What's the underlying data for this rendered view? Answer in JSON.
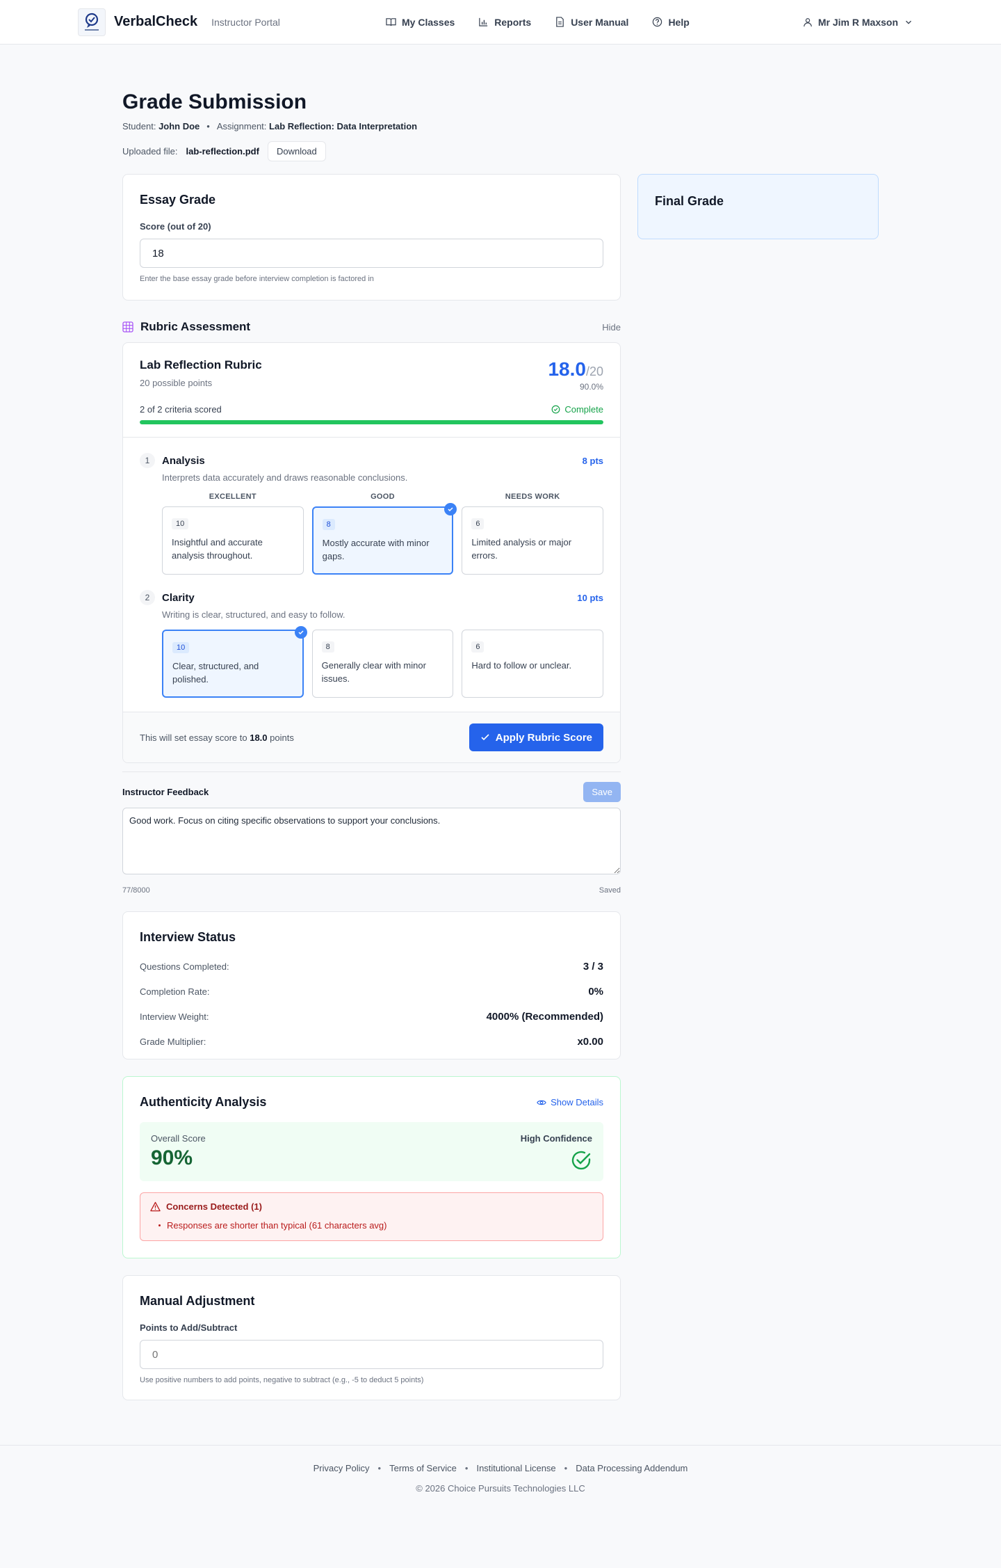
{
  "header": {
    "brand": "VerbalCheck",
    "portal": "Instructor Portal",
    "nav": [
      {
        "label": "My Classes",
        "icon": "book-icon"
      },
      {
        "label": "Reports",
        "icon": "bar-chart-icon"
      },
      {
        "label": "User Manual",
        "icon": "document-icon"
      },
      {
        "label": "Help",
        "icon": "help-circle-icon"
      }
    ],
    "user": "Mr Jim R Maxson"
  },
  "page": {
    "title": "Grade Submission",
    "student_label": "Student:",
    "student_name": "John Doe",
    "assignment_label": "Assignment:",
    "assignment_name": "Lab Reflection: Data Interpretation",
    "uploaded_label": "Uploaded file:",
    "file_name": "lab-reflection.pdf",
    "download_label": "Download"
  },
  "essay": {
    "title": "Essay Grade",
    "score_label": "Score (out of 20)",
    "score_value": "18",
    "hint": "Enter the base essay grade before interview completion is factored in"
  },
  "final_grade": {
    "title": "Final Grade"
  },
  "rubric": {
    "section_title": "Rubric Assessment",
    "hide_label": "Hide",
    "name": "Lab Reflection Rubric",
    "possible": "20 possible points",
    "score": "18.0",
    "out_of": "/20",
    "percent": "90.0%",
    "criteria_scored": "2 of 2 criteria scored",
    "complete_label": "Complete",
    "progress": 1.0,
    "level_headers": [
      "EXCELLENT",
      "GOOD",
      "NEEDS WORK"
    ],
    "criteria": [
      {
        "num": "1",
        "name": "Analysis",
        "points": "8 pts",
        "desc": "Interprets data accurately and draws reasonable conclusions.",
        "levels": [
          {
            "pts": "10",
            "text": "Insightful and accurate analysis throughout.",
            "selected": false
          },
          {
            "pts": "8",
            "text": "Mostly accurate with minor gaps.",
            "selected": true
          },
          {
            "pts": "6",
            "text": "Limited analysis or major errors.",
            "selected": false
          }
        ]
      },
      {
        "num": "2",
        "name": "Clarity",
        "points": "10 pts",
        "desc": "Writing is clear, structured, and easy to follow.",
        "levels": [
          {
            "pts": "10",
            "text": "Clear, structured, and polished.",
            "selected": true
          },
          {
            "pts": "8",
            "text": "Generally clear with minor issues.",
            "selected": false
          },
          {
            "pts": "6",
            "text": "Hard to follow or unclear.",
            "selected": false
          }
        ]
      }
    ],
    "footer_prefix": "This will set essay score to ",
    "footer_score": "18.0",
    "footer_suffix": " points",
    "apply_label": "Apply Rubric Score"
  },
  "feedback": {
    "label": "Instructor Feedback",
    "save_label": "Save",
    "text": "Good work. Focus on citing specific observations to support your conclusions.",
    "count": "77/8000",
    "status": "Saved"
  },
  "interview": {
    "title": "Interview Status",
    "rows": [
      {
        "label": "Questions Completed:",
        "value": "3 / 3"
      },
      {
        "label": "Completion Rate:",
        "value": "0%"
      },
      {
        "label": "Interview Weight:",
        "value": "4000% (Recommended)"
      },
      {
        "label": "Grade Multiplier:",
        "value": "x0.00"
      }
    ]
  },
  "authenticity": {
    "title": "Authenticity Analysis",
    "show_details": "Show Details",
    "overall_label": "Overall Score",
    "overall_value": "90%",
    "confidence": "High Confidence",
    "concerns_title": "Concerns Detected (1)",
    "concerns": [
      "Responses are shorter than typical (61 characters avg)"
    ]
  },
  "manual": {
    "title": "Manual Adjustment",
    "label": "Points to Add/Subtract",
    "placeholder": "0",
    "hint": "Use positive numbers to add points, negative to subtract (e.g., -5 to deduct 5 points)"
  },
  "footer": {
    "links": [
      "Privacy Policy",
      "Terms of Service",
      "Institutional License",
      "Data Processing Addendum"
    ],
    "copyright": "© 2026 Choice Pursuits Technologies LLC"
  },
  "colors": {
    "accent": "#2563eb",
    "success": "#22c55e",
    "danger": "#b91c1c"
  }
}
